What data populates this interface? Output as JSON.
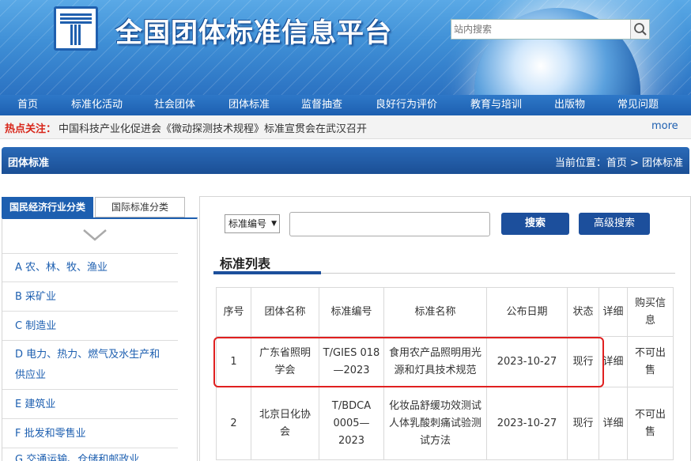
{
  "header": {
    "site_title": "全国团体标准信息平台",
    "search_placeholder": "站内搜索"
  },
  "nav": [
    "首页",
    "标准化活动",
    "社会团体",
    "团体标准",
    "监督抽查",
    "良好行为评价",
    "教育与培训",
    "出版物",
    "常见问题"
  ],
  "hot": {
    "label": "热点关注：",
    "text": "中国科技产业化促进会《微动探测技术规程》标准宣贯会在武汉召开",
    "more": "more"
  },
  "section": {
    "title": "团体标准",
    "breadcrumb": "当前位置：首页 > 团体标准"
  },
  "left": {
    "tabs": [
      "国民经济行业分类",
      "国际标准分类"
    ],
    "categories": [
      "A 农、林、牧、渔业",
      "B 采矿业",
      "C 制造业",
      "D 电力、热力、燃气及水生产和供应业",
      "E 建筑业",
      "F 批发和零售业",
      "G 交通运输、仓储和邮政业"
    ]
  },
  "search": {
    "select_value": "标准编号",
    "search_label": "搜索",
    "advanced_label": "高级搜索"
  },
  "list": {
    "title": "标准列表",
    "columns": [
      "序号",
      "团体名称",
      "标准编号",
      "标准名称",
      "公布日期",
      "状态",
      "详细",
      "购买信息"
    ],
    "rows": [
      {
        "no": "1",
        "org": "广东省照明学会",
        "code": "T/GIES 018—2023",
        "name": "食用农产品照明用光源和灯具技术规范",
        "date": "2023-10-27",
        "status": "现行",
        "detail": "详细",
        "buy": "不可出售"
      },
      {
        "no": "2",
        "org": "北京日化协会",
        "code": "T/BDCA 0005—2023",
        "name": "化妆品舒缓功效测试人体乳酸刺痛试验测试方法",
        "date": "2023-10-27",
        "status": "现行",
        "detail": "详细",
        "buy": "不可出售"
      }
    ]
  },
  "colors": {
    "brand": "#1d5fb0",
    "hot": "#d8261a",
    "highlight": "#e02020"
  }
}
